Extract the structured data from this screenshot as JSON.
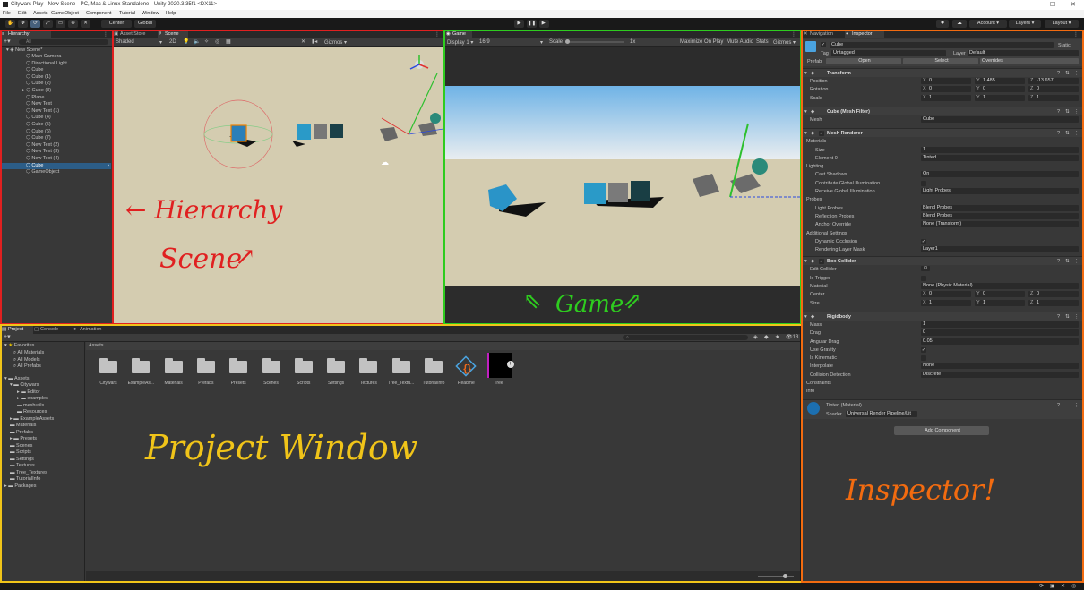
{
  "titlebar": {
    "title": "Citywars Play - New Scene - PC, Mac & Linux Standalone - Unity 2020.3.35f1 <DX11>",
    "min": "–",
    "max": "☐",
    "close": "✕"
  },
  "menu": [
    "File",
    "Edit",
    "Assets",
    "GameObject",
    "Component",
    "Tutorial",
    "Window",
    "Help"
  ],
  "toolbar": {
    "pivot": "Center",
    "space": "Global",
    "account": "Account",
    "layers": "Layers",
    "layout": "Layout"
  },
  "hierarchy": {
    "tab": "Hierarchy",
    "search_placeholder": "All",
    "scene": "New Scene*",
    "items": [
      "Main Camera",
      "Directional Light",
      "Cube",
      "Cube (1)",
      "Cube (2)",
      "Cube (3)",
      "Plane",
      "New Text",
      "New Text (1)",
      "Cube (4)",
      "Cube (5)",
      "Cube (6)",
      "Cube (7)",
      "New Text (2)",
      "New Text (3)",
      "New Text (4)",
      "Cube",
      "GameObject"
    ]
  },
  "scene": {
    "tabs": [
      "Asset Store",
      "Scene"
    ],
    "shading": "Shaded",
    "mode2d": "2D",
    "gizmos": "Gizmos"
  },
  "game": {
    "tab": "Game",
    "display": "Display 1",
    "aspect": "16:9",
    "scale_label": "Scale",
    "scale_value": "1x",
    "maximize": "Maximize On Play",
    "mute": "Mute Audio",
    "stats": "Stats",
    "gizmos": "Gizmos"
  },
  "project": {
    "tabs": [
      "Project",
      "Console",
      "Animation"
    ],
    "path": "Assets",
    "favorites": {
      "title": "Favorites",
      "items": [
        "All Materials",
        "All Models",
        "All Prefabs"
      ]
    },
    "assets_title": "Assets",
    "tree": [
      "Citywars",
      "Editor",
      "examples",
      "meshutils",
      "Resources",
      "ExampleAssets",
      "Materials",
      "Prefabs",
      "Presets",
      "Scenes",
      "Scripts",
      "Settings",
      "Textures",
      "Tree_Textures",
      "TutorialInfo"
    ],
    "packages": "Packages",
    "grid": [
      "Citywars",
      "ExampleAs...",
      "Materials",
      "Prefabs",
      "Presets",
      "Scenes",
      "Scripts",
      "Settings",
      "Textures",
      "Tree_Textu...",
      "TutorialInfo",
      "Readme",
      "Tree"
    ],
    "slider_count": "13"
  },
  "inspector": {
    "tabs": [
      "Navigation",
      "Inspector"
    ],
    "object_name": "Cube",
    "static": "Static",
    "tag_label": "Tag",
    "tag": "Untagged",
    "layer_label": "Layer",
    "layer": "Default",
    "prefab_label": "Prefab",
    "prefab_open": "Open",
    "prefab_select": "Select",
    "prefab_overrides": "Overrides",
    "transform": {
      "title": "Transform",
      "position": {
        "label": "Position",
        "x": "0",
        "y": "1.485",
        "z": "-13.657"
      },
      "rotation": {
        "label": "Rotation",
        "x": "0",
        "y": "0",
        "z": "0"
      },
      "scale": {
        "label": "Scale",
        "x": "1",
        "y": "1",
        "z": "1"
      }
    },
    "meshfilter": {
      "title": "Cube (Mesh Filter)",
      "mesh_label": "Mesh",
      "mesh": "Cube"
    },
    "renderer": {
      "title": "Mesh Renderer",
      "materials": "Materials",
      "size_label": "Size",
      "size": "1",
      "el0_label": "Element 0",
      "el0": "Tinted",
      "lighting": "Lighting",
      "cast_label": "Cast Shadows",
      "cast": "On",
      "contrib": "Contribute Global Illumination",
      "receive_label": "Receive Global Illumination",
      "receive": "Light Probes",
      "probes": "Probes",
      "lightp_label": "Light Probes",
      "lightp": "Blend Probes",
      "reflp_label": "Reflection Probes",
      "reflp": "Blend Probes",
      "anchor_label": "Anchor Override",
      "anchor": "None (Transform)",
      "additional": "Additional Settings",
      "dyn_label": "Dynamic Occlusion",
      "layermask_label": "Rendering Layer Mask",
      "layermask": "Layer1"
    },
    "collider": {
      "title": "Box Collider",
      "edit": "Edit Collider",
      "trigger": "Is Trigger",
      "material_label": "Material",
      "material": "None (Physic Material)",
      "center": {
        "label": "Center",
        "x": "0",
        "y": "0",
        "z": "0"
      },
      "size": {
        "label": "Size",
        "x": "1",
        "y": "1",
        "z": "1"
      }
    },
    "rigidbody": {
      "title": "Rigidbody",
      "mass_label": "Mass",
      "mass": "1",
      "drag_label": "Drag",
      "drag": "0",
      "adrag_label": "Angular Drag",
      "adrag": "0.05",
      "gravity": "Use Gravity",
      "kinematic": "Is Kinematic",
      "interp_label": "Interpolate",
      "interp": "None",
      "coll_label": "Collision Detection",
      "coll": "Discrete",
      "constraints": "Constraints",
      "info": "Info"
    },
    "material": {
      "title": "Tinted (Material)",
      "shader_label": "Shader",
      "shader": "Universal Render Pipeline/Lit"
    },
    "add_component": "Add Component"
  },
  "annotations": {
    "hierarchy": "← Hierarchy",
    "scene": "Scene",
    "game": "Game",
    "project": "Project Window",
    "inspector": "Inspector!"
  },
  "colors": {
    "hierarchy_frame": "#e02020",
    "game_frame": "#2ecc1f",
    "project_frame": "#f0c419",
    "inspector_frame": "#f26b10",
    "select": "#2c5d87"
  }
}
